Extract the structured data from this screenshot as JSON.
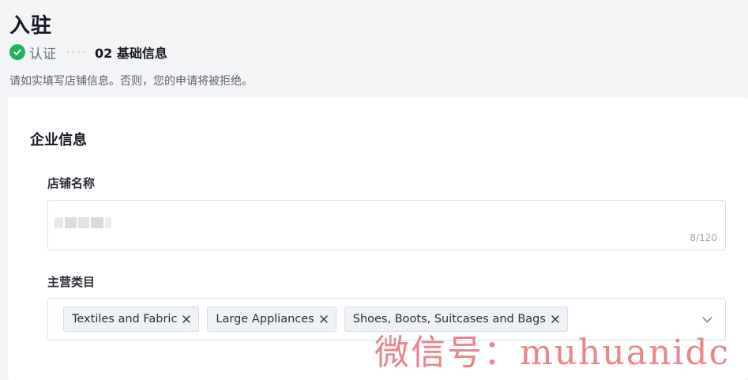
{
  "header": {
    "title": "入驻"
  },
  "steps": {
    "completed_label": "认证",
    "current_label": "02 基础信息"
  },
  "notice": "请如实填写店铺信息。否则，您的申请将被拒绝。",
  "section": {
    "title": "企业信息"
  },
  "store_name": {
    "label": "店铺名称",
    "char_count": "8/120"
  },
  "category": {
    "label": "主营类目",
    "tags": [
      {
        "label": "Textiles and Fabric"
      },
      {
        "label": "Large Appliances"
      },
      {
        "label": "Shoes, Boots, Suitcases and Bags"
      }
    ]
  },
  "watermark": "微信号：muhuanidc",
  "colors": {
    "success": "#22b35e",
    "tag_bg": "#eef1f6",
    "watermark": "#e8868a"
  }
}
